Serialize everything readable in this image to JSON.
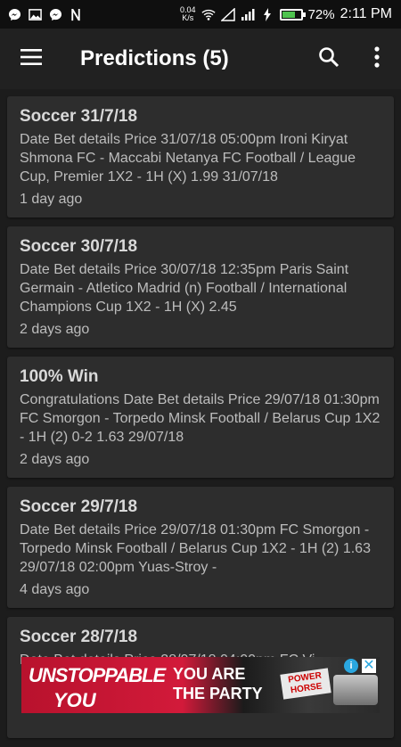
{
  "status_bar": {
    "network_speed_value": "0.04",
    "network_speed_unit": "K/s",
    "battery_percent": "72%",
    "battery_level": 0.72,
    "time": "2:11 PM",
    "notification_icons": [
      "messenger-icon",
      "image-icon",
      "messenger-icon",
      "n-icon"
    ]
  },
  "app_bar": {
    "title": "Predictions (5)",
    "menu_icon": "hamburger-menu-icon",
    "search_icon": "search-icon",
    "more_icon": "more-vertical-icon"
  },
  "cards": [
    {
      "title": "Soccer 31/7/18",
      "body": "Date Bet details Price 31/07/18 05:00pm Ironi Kiryat Shmona FC - Maccabi Netanya FC Football / League Cup, Premier 1X2 - 1H (X)   1.99 31/07/18",
      "time": "1 day ago"
    },
    {
      "title": "Soccer 30/7/18",
      "body": "Date Bet details Price 30/07/18 12:35pm Paris Saint Germain - Atletico Madrid (n) Football / International Champions Cup 1X2 - 1H (X)   2.45",
      "time": "2 days ago"
    },
    {
      "title": "100% Win",
      "body": "Congratulations Date Bet details Price 29/07/18 01:30pm FC Smorgon - Torpedo Minsk Football / Belarus Cup 1X2 - 1H (2) 0-2   1.63 29/07/18",
      "time": "2 days ago"
    },
    {
      "title": "Soccer 29/7/18",
      "body": "Date Bet details Price 29/07/18 01:30pm FC Smorgon - Torpedo Minsk Football / Belarus Cup 1X2 - 1H (2)   1.63 29/07/18 02:00pm Yuas-Stroy -",
      "time": "4 days ago"
    },
    {
      "title": "Soccer 28/7/18",
      "body": "Date Bet details Price 28/07/18 04:00pm FC Vi",
      "time": ""
    }
  ],
  "ad": {
    "line1": "UNSTOPPABLE",
    "line2": "YOU",
    "line3a": "YOU ARE",
    "line3b": "THE PARTY",
    "brand": "POWER HORSE",
    "info": "i",
    "close": "✕"
  }
}
